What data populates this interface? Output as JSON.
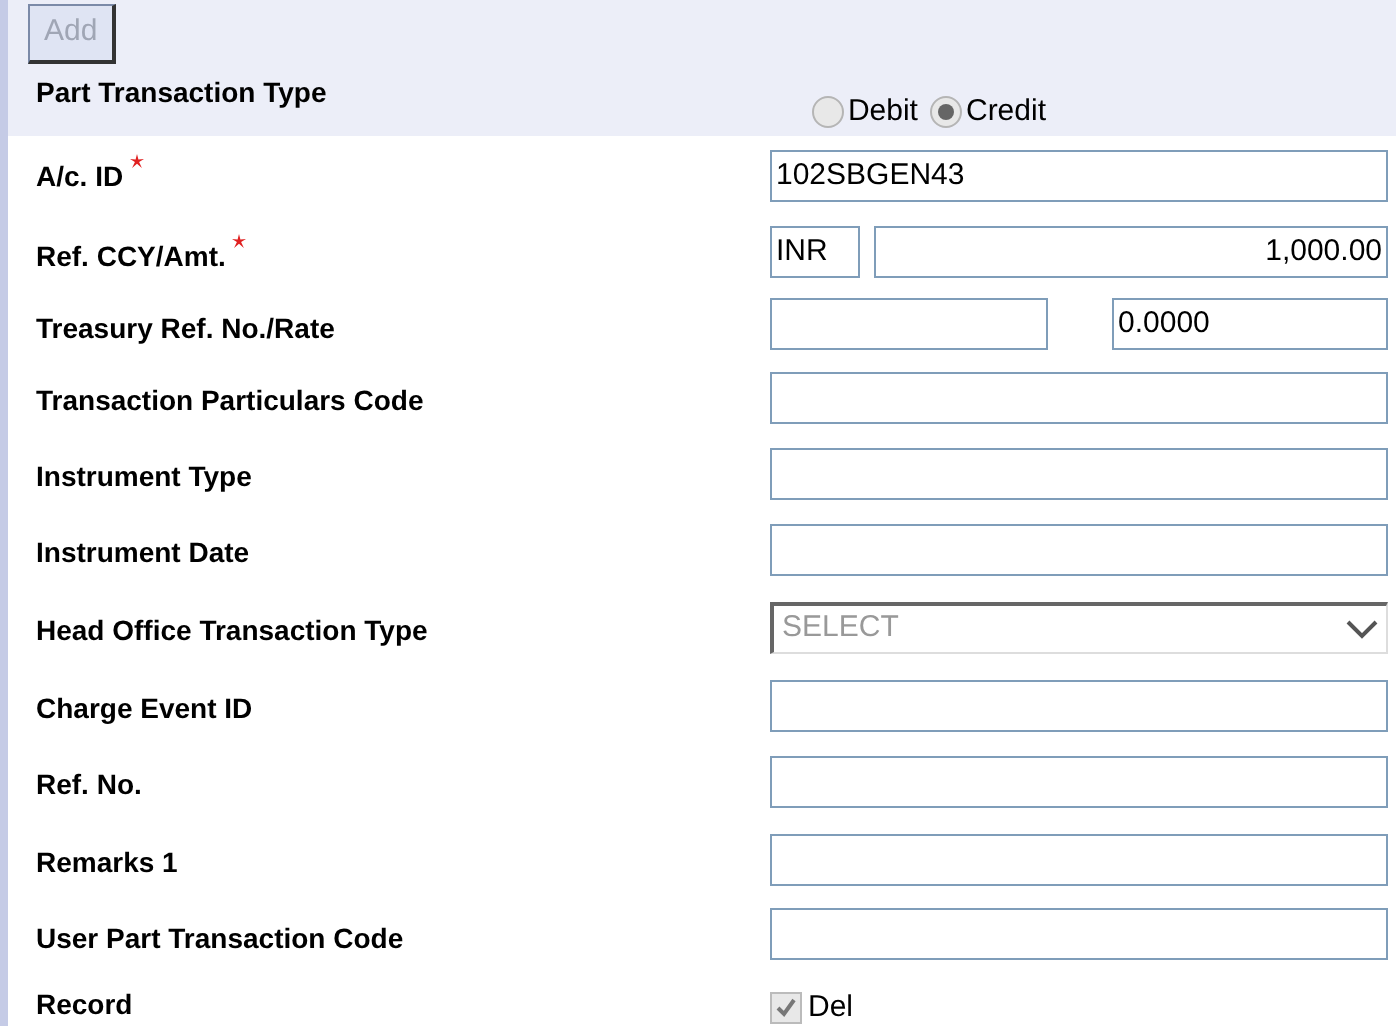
{
  "add_button": {
    "label": "Add",
    "disabled": true
  },
  "part_transaction_type": {
    "label": "Part Transaction Type",
    "options": [
      {
        "label": "Debit",
        "selected": false
      },
      {
        "label": "Credit",
        "selected": true
      }
    ]
  },
  "fields": [
    {
      "kind": "text",
      "label": "A/c. ID",
      "required": true,
      "value": "102SBGEN43"
    },
    {
      "kind": "pair",
      "label": "Ref. CCY/Amt.",
      "required": true,
      "values": [
        "INR",
        "1,000.00"
      ]
    },
    {
      "kind": "split",
      "label": "Treasury Ref. No./Rate",
      "required": false,
      "rate": "0.0000"
    },
    {
      "kind": "text",
      "label": "Transaction Particulars Code",
      "required": false
    },
    {
      "kind": "text",
      "label": "Instrument Type",
      "required": false
    },
    {
      "kind": "text",
      "label": "Instrument Date",
      "required": false
    },
    {
      "kind": "select",
      "label": "Head Office Transaction Type",
      "required": false,
      "value": "SELECT"
    },
    {
      "kind": "text",
      "label": "Charge Event ID",
      "required": false
    },
    {
      "kind": "text",
      "label": "Ref. No.",
      "required": false
    },
    {
      "kind": "text",
      "label": "Remarks 1",
      "required": false
    },
    {
      "kind": "text",
      "label": "User Part Transaction Code",
      "required": false
    },
    {
      "kind": "checkbox",
      "label": "Record",
      "required": false,
      "option": "Del",
      "checked": true
    }
  ]
}
